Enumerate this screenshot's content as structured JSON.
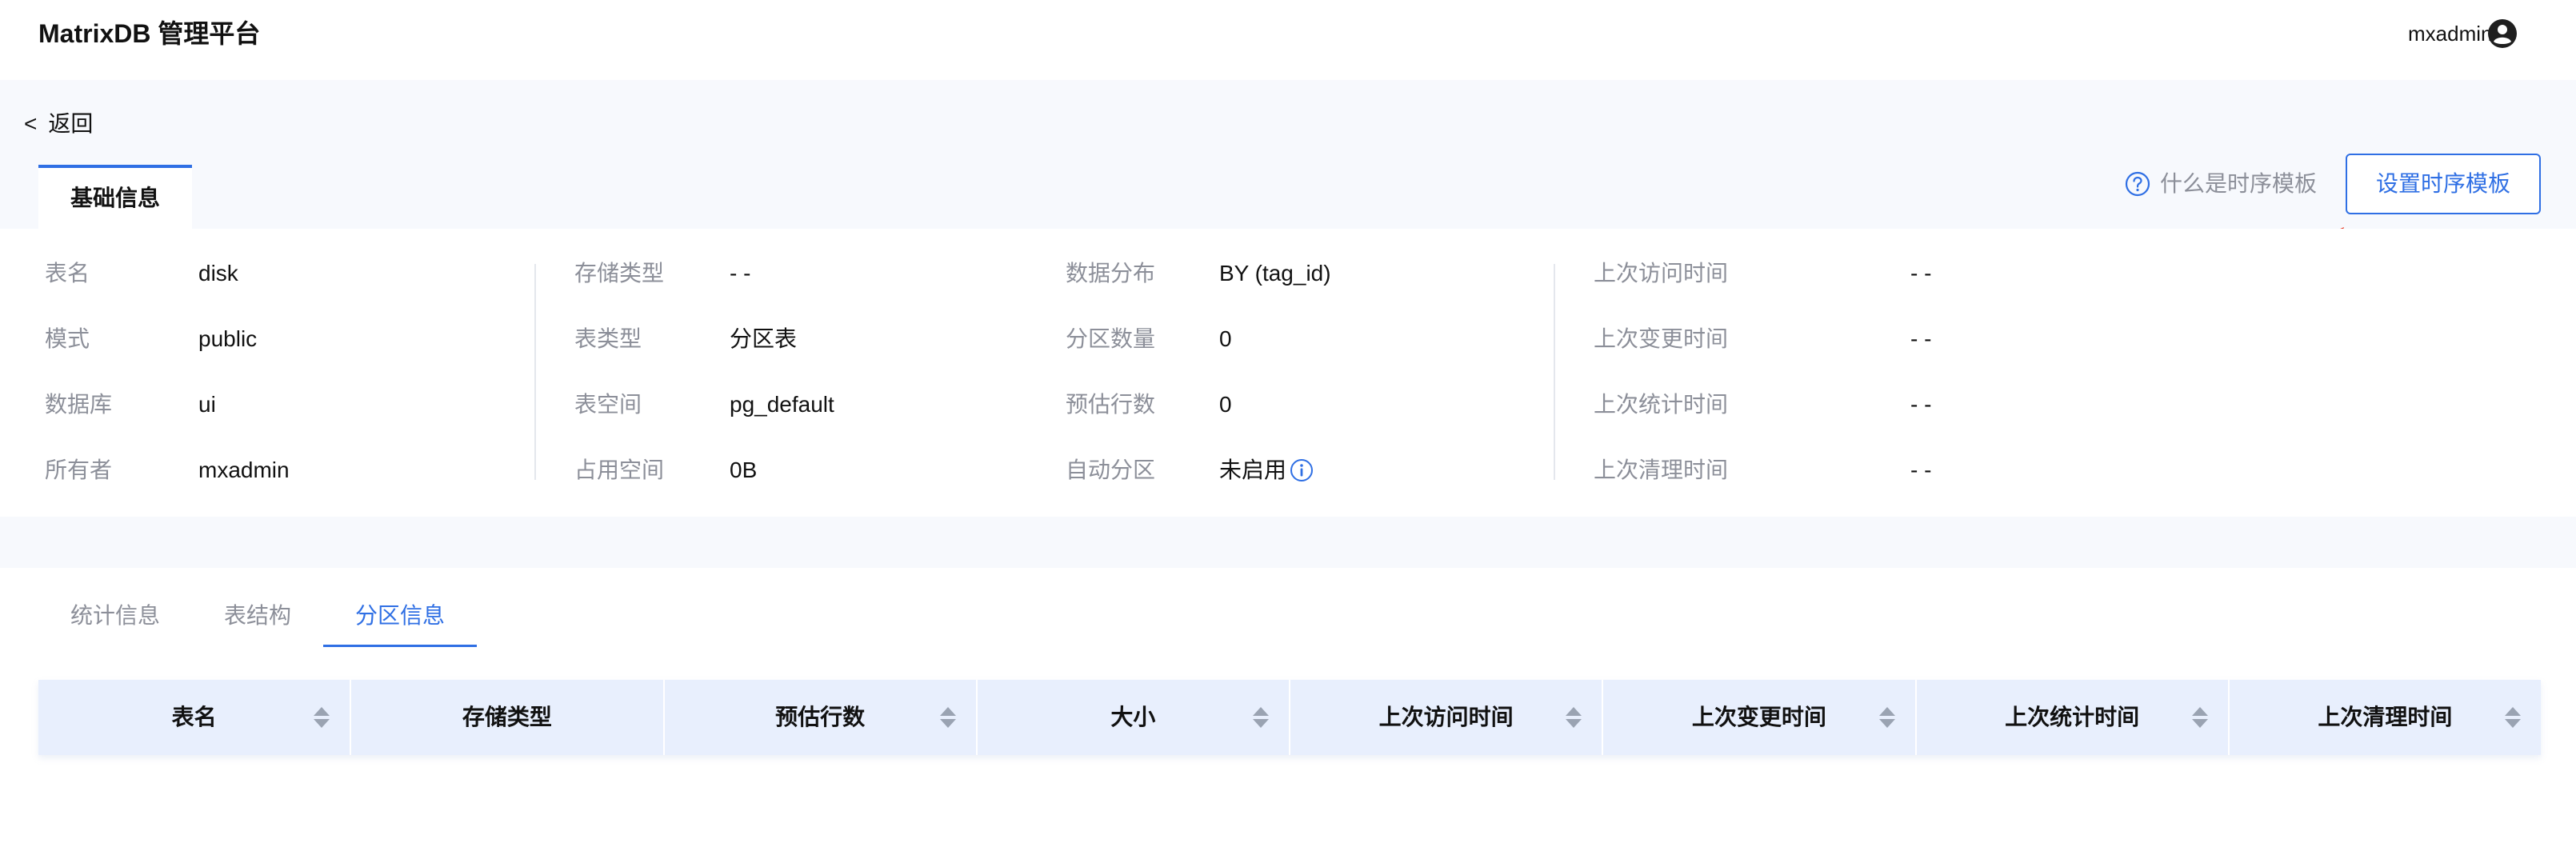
{
  "header": {
    "app_title": "MatrixDB 管理平台",
    "user_name": "mxadmin",
    "user_icon": "account-circle-icon"
  },
  "nav": {
    "back_chevron": "<",
    "back_label": "返回"
  },
  "tabs": {
    "basic_info": "基础信息"
  },
  "actions": {
    "help_text": "什么是时序模板",
    "help_icon": "question-circle-icon",
    "set_template_label": "设置时序模板"
  },
  "info": {
    "col1": [
      {
        "label": "表名",
        "value": "disk"
      },
      {
        "label": "模式",
        "value": "public"
      },
      {
        "label": "数据库",
        "value": "ui"
      },
      {
        "label": "所有者",
        "value": "mxadmin"
      }
    ],
    "col2": [
      {
        "label": "存储类型",
        "value": "- -"
      },
      {
        "label": "表类型",
        "value": "分区表"
      },
      {
        "label": "表空间",
        "value": "pg_default"
      },
      {
        "label": "占用空间",
        "value": "0B"
      }
    ],
    "col3": [
      {
        "label": "数据分布",
        "value": "BY (tag_id)"
      },
      {
        "label": "分区数量",
        "value": "0"
      },
      {
        "label": "预估行数",
        "value": "0"
      },
      {
        "label": "自动分区",
        "value": "未启用"
      }
    ],
    "col4": [
      {
        "label": "上次访问时间",
        "value": "- -"
      },
      {
        "label": "上次变更时间",
        "value": "- -"
      },
      {
        "label": "上次统计时间",
        "value": "- -"
      },
      {
        "label": "上次清理时间",
        "value": "- -"
      }
    ]
  },
  "subtabs": [
    {
      "label": "统计信息",
      "active": false
    },
    {
      "label": "表结构",
      "active": false
    },
    {
      "label": "分区信息",
      "active": true
    }
  ],
  "table": {
    "columns": [
      {
        "label": "表名",
        "sortable": true
      },
      {
        "label": "存储类型",
        "sortable": false
      },
      {
        "label": "预估行数",
        "sortable": true
      },
      {
        "label": "大小",
        "sortable": true
      },
      {
        "label": "上次访问时间",
        "sortable": true
      },
      {
        "label": "上次变更时间",
        "sortable": true
      },
      {
        "label": "上次统计时间",
        "sortable": true
      },
      {
        "label": "上次清理时间",
        "sortable": true
      }
    ]
  },
  "colors": {
    "accent": "#2f6fe4",
    "annotation_arrow": "#e8432e",
    "band_background": "#f7f9fd",
    "table_header_background": "#e8effd"
  }
}
